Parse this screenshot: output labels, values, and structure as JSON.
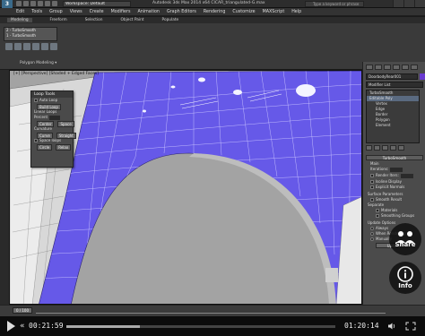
{
  "titlebar": {
    "logo": "3",
    "workspace": "Workspace: Default",
    "title": "Autodesk 3ds Max 2014 x64      CICAR_triangulated-G.max",
    "search_placeholder": "Type a keyword or phrase"
  },
  "menu": [
    "Edit",
    "Tools",
    "Group",
    "Views",
    "Create",
    "Modifiers",
    "Animation",
    "Graph Editors",
    "Rendering",
    "Customize",
    "MAXScript",
    "Help"
  ],
  "ribbon": {
    "tabs": [
      "Modeling",
      "Freeform",
      "Selection",
      "Object Paint",
      "Populate"
    ],
    "stack_items": [
      "2 - TurboSmooth",
      "1 - TurboSmooth"
    ],
    "group_label": "Polygon Modeling ▾"
  },
  "viewport": {
    "label": "[+] [Perspective] [Shaded + Edged Faces]"
  },
  "loop_tools": {
    "title": "Loop Tools",
    "auto_loop": "Auto Loop",
    "build_loop": "Build Loop",
    "linear_loops": "Linear Loops",
    "percent": "Percent",
    "center": "Center",
    "space": "Space",
    "curvature": "Curvature",
    "curve": "Curve",
    "straight": "Straight",
    "space_loops": "Space loops",
    "circle": "Circle",
    "relax": "Relax"
  },
  "command_panel": {
    "object_name": "DoorbodyRear001",
    "modifier_list": "Modifier List",
    "stack": [
      "TurboSmooth",
      "Editable Poly",
      "Vertex",
      "Edge",
      "Border",
      "Polygon",
      "Element"
    ],
    "rollouts": {
      "turbosmooth": "TurboSmooth",
      "main": "Main",
      "iterations": "Iterations:",
      "render_iters": "Render Iters:",
      "isoline": "Isoline Display",
      "explicit_normals": "Explicit Normals",
      "surface_params": "Surface Parameters",
      "smooth_result": "Smooth Result",
      "separate": "Separate",
      "materials": "Materials",
      "smoothing_groups": "Smoothing Groups",
      "update_options": "Update Options",
      "always": "Always",
      "when_rendering": "When Rendering",
      "manually": "Manually",
      "update": "Update"
    }
  },
  "overlay": {
    "share_label": "Share",
    "info_label": "Info"
  },
  "timeline": {
    "frame": "0 / 100"
  },
  "player": {
    "current_time": "00:21:59",
    "total_time": "01:20:14",
    "progress": 0.274
  },
  "colors": {
    "mesh_selected": "#6659e8",
    "mesh_grey": "#e6e6e6",
    "viewport_bg": "#a3a3a3"
  }
}
